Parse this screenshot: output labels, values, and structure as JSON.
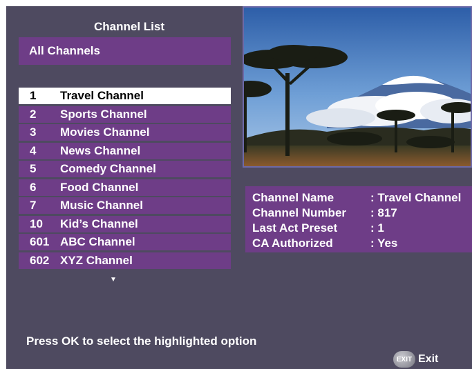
{
  "header": {
    "title": "Channel List",
    "group": "All Channels"
  },
  "channels": [
    {
      "num": "1",
      "name": "Travel Channel",
      "selected": true
    },
    {
      "num": "2",
      "name": "Sports Channel"
    },
    {
      "num": "3",
      "name": "Movies Channel"
    },
    {
      "num": "4",
      "name": "News Channel"
    },
    {
      "num": "5",
      "name": "Comedy Channel"
    },
    {
      "num": "6",
      "name": "Food Channel"
    },
    {
      "num": "7",
      "name": "Music Channel"
    },
    {
      "num": "10",
      "name": "Kid’s Channel"
    },
    {
      "num": "601",
      "name": "ABC Channel"
    },
    {
      "num": "602",
      "name": "XYZ Channel"
    }
  ],
  "scroll": {
    "more_icon": "▼"
  },
  "info": {
    "rows": [
      {
        "label": "Channel Name",
        "value": ": Travel Channel"
      },
      {
        "label": "Channel Number",
        "value": ": 817"
      },
      {
        "label": "Last Act Preset",
        "value": ": 1"
      },
      {
        "label": "CA Authorized",
        "value": ": Yes"
      }
    ]
  },
  "footer": {
    "hint": "Press OK to select the highlighted option",
    "exit_button": "EXIT",
    "exit_label": "Exit"
  },
  "colors": {
    "background": "#4e4a60",
    "panel": "#6e3d87",
    "highlight": "#ffffff",
    "preview_border": "#6d6aa8"
  }
}
